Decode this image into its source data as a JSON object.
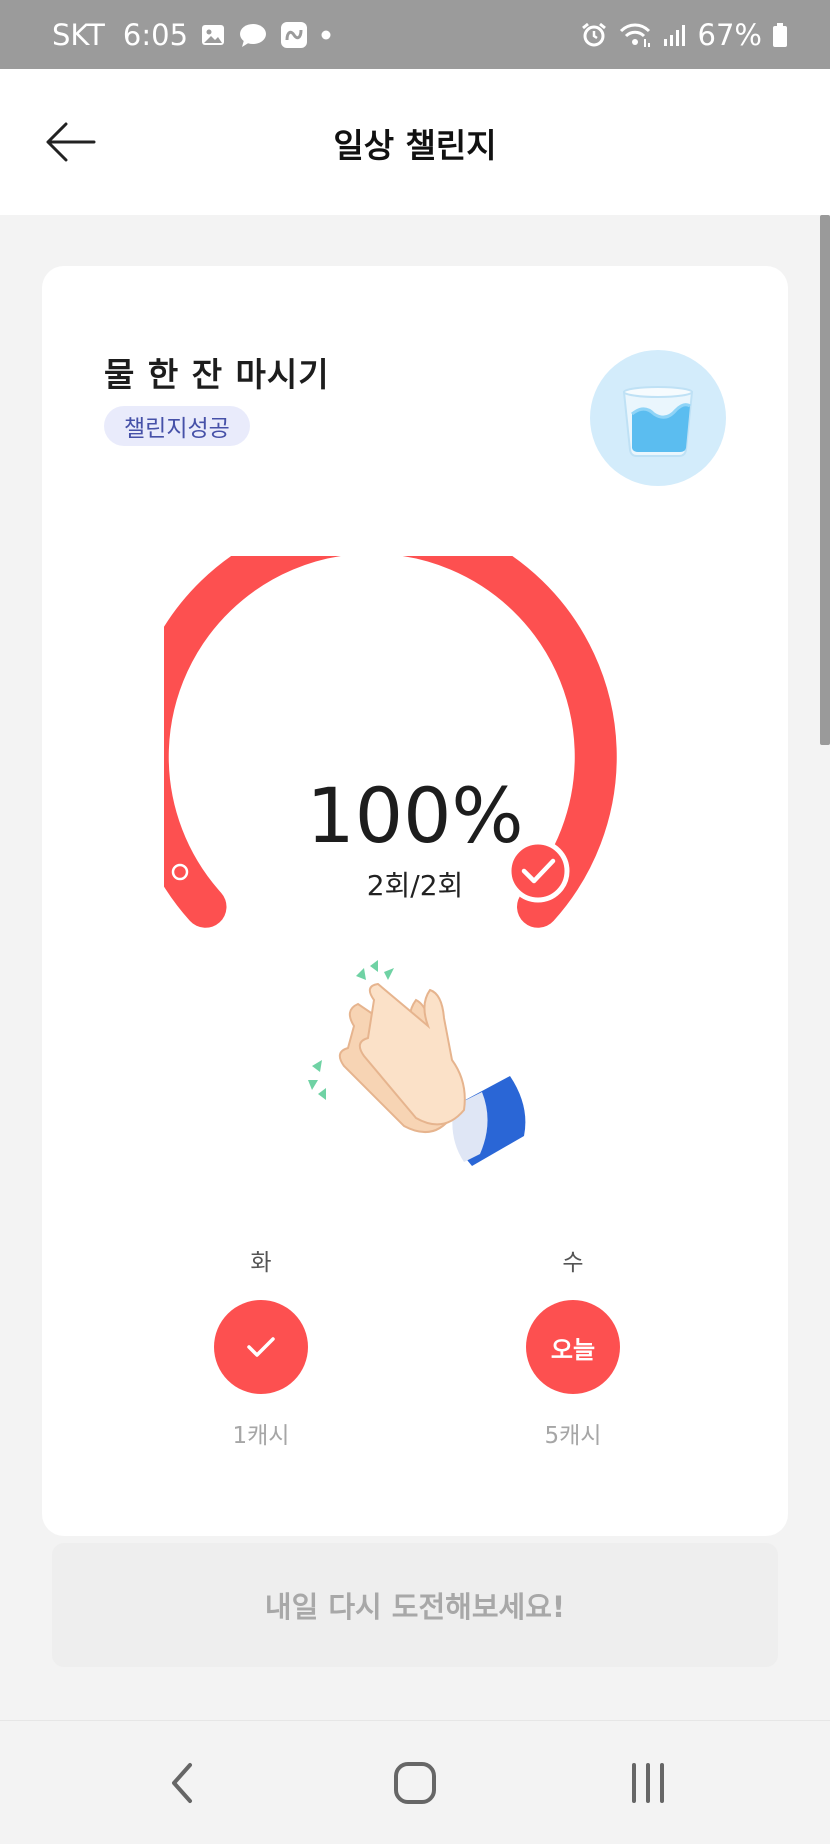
{
  "status_bar": {
    "carrier": "SKT",
    "time": "6:05",
    "battery": "67%",
    "icons_left": [
      "image-icon",
      "chat-bubble-icon",
      "naver-icon",
      "dot-icon"
    ],
    "icons_right": [
      "alarm-icon",
      "wifi-icon",
      "signal-icon",
      "battery-icon"
    ]
  },
  "header": {
    "title": "일상 챌린지",
    "back_icon": "arrow-left-icon"
  },
  "challenge": {
    "name": "물 한 잔 마시기",
    "badge": "챌린지성공",
    "percent_text": "100%",
    "count_text": "2회/2회",
    "progress": 1.0,
    "accent_color": "#fd5050",
    "badge_bg": "#e9ebfb",
    "badge_text_color": "#4651a8"
  },
  "days": [
    {
      "label": "화",
      "state": "done",
      "icon": "check-icon",
      "reward": "1캐시"
    },
    {
      "label": "수",
      "state": "today",
      "text": "오늘",
      "reward": "5캐시"
    }
  ],
  "retry_button": {
    "label": "내일 다시 도전해보세요!"
  },
  "nav_bar": {
    "icons": [
      "nav-back-icon",
      "nav-home-icon",
      "nav-recents-icon"
    ]
  }
}
